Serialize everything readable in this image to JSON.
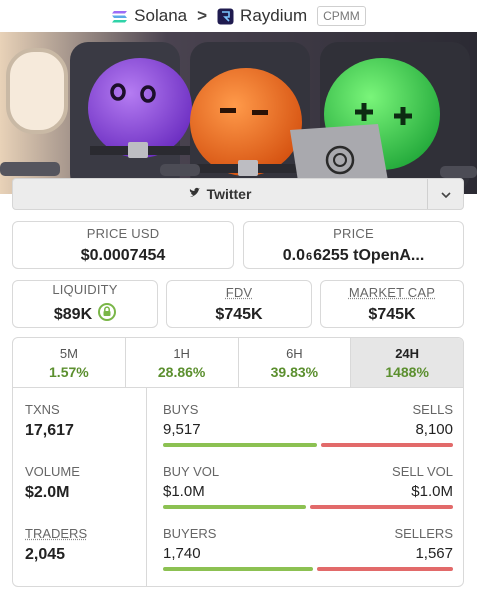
{
  "breadcrumb": {
    "chain": "Solana",
    "dex": "Raydium",
    "pool_type": "CPMM"
  },
  "banner": {
    "alt_icons": [
      "openai-logo-icon"
    ]
  },
  "social": {
    "twitter_label": "Twitter"
  },
  "price_usd": {
    "label": "PRICE USD",
    "value": "$0.0007454"
  },
  "price": {
    "label": "PRICE",
    "prefix": "0.0",
    "sub": "6",
    "rest": "6255 tOpenA..."
  },
  "liquidity": {
    "label": "LIQUIDITY",
    "value": "$89K"
  },
  "fdv": {
    "label": "FDV",
    "value": "$745K"
  },
  "market_cap": {
    "label": "MARKET CAP",
    "value": "$745K"
  },
  "timeframes": [
    {
      "label": "5M",
      "change": "1.57%"
    },
    {
      "label": "1H",
      "change": "28.86%"
    },
    {
      "label": "6H",
      "change": "39.83%"
    },
    {
      "label": "24H",
      "change": "1488%",
      "active": true
    }
  ],
  "txns": {
    "label": "TXNS",
    "value": "17,617"
  },
  "volume": {
    "label": "VOLUME",
    "value": "$2.0M"
  },
  "traders": {
    "label": "TRADERS",
    "value": "2,045"
  },
  "buys_sells": {
    "left_label": "BUYS",
    "left_value": "9,517",
    "right_label": "SELLS",
    "right_value": "8,100",
    "buy_fraction": 0.54
  },
  "buy_sell_vol": {
    "left_label": "BUY VOL",
    "left_value": "$1.0M",
    "right_label": "SELL VOL",
    "right_value": "$1.0M",
    "buy_fraction": 0.5
  },
  "buyers_sellers": {
    "left_label": "BUYERS",
    "left_value": "1,740",
    "right_label": "SELLERS",
    "right_value": "1,567",
    "buy_fraction": 0.526
  },
  "colors": {
    "positive": "#5b8f2e",
    "buy_bar": "#8cc152",
    "sell_bar": "#e26a6a"
  }
}
